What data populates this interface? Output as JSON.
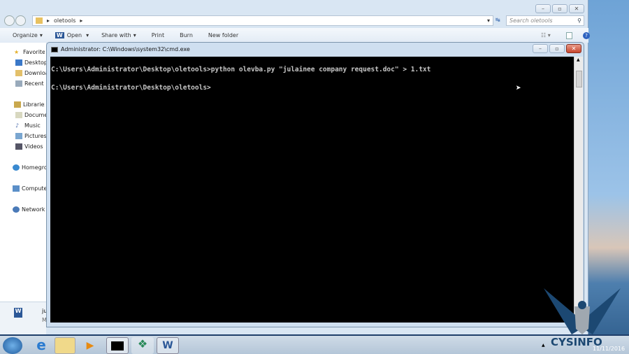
{
  "explorer": {
    "breadcrumb": "oletools",
    "search_placeholder": "Search oletools",
    "toolbar": [
      "Organize",
      "Open",
      "Share with",
      "Print",
      "Burn",
      "New folder"
    ],
    "sidebar": [
      "Favorites",
      "Desktop",
      "Downloads",
      "Recent Places",
      "Libraries",
      "Documents",
      "Music",
      "Pictures",
      "Videos",
      "Homegroup",
      "Computer",
      "Network"
    ],
    "details_name": "ju",
    "details_type": "M"
  },
  "cmd": {
    "title": "Administrator: C:\\Windows\\system32\\cmd.exe",
    "lines": [
      "C:\\Users\\Administrator\\Desktop\\oletools>python olevba.py \"julainee company request.doc\" > 1.txt",
      "C:\\Users\\Administrator\\Desktop\\oletools>"
    ]
  },
  "watermark": "CYSINFO",
  "clock": {
    "date": "11/11/2016"
  }
}
